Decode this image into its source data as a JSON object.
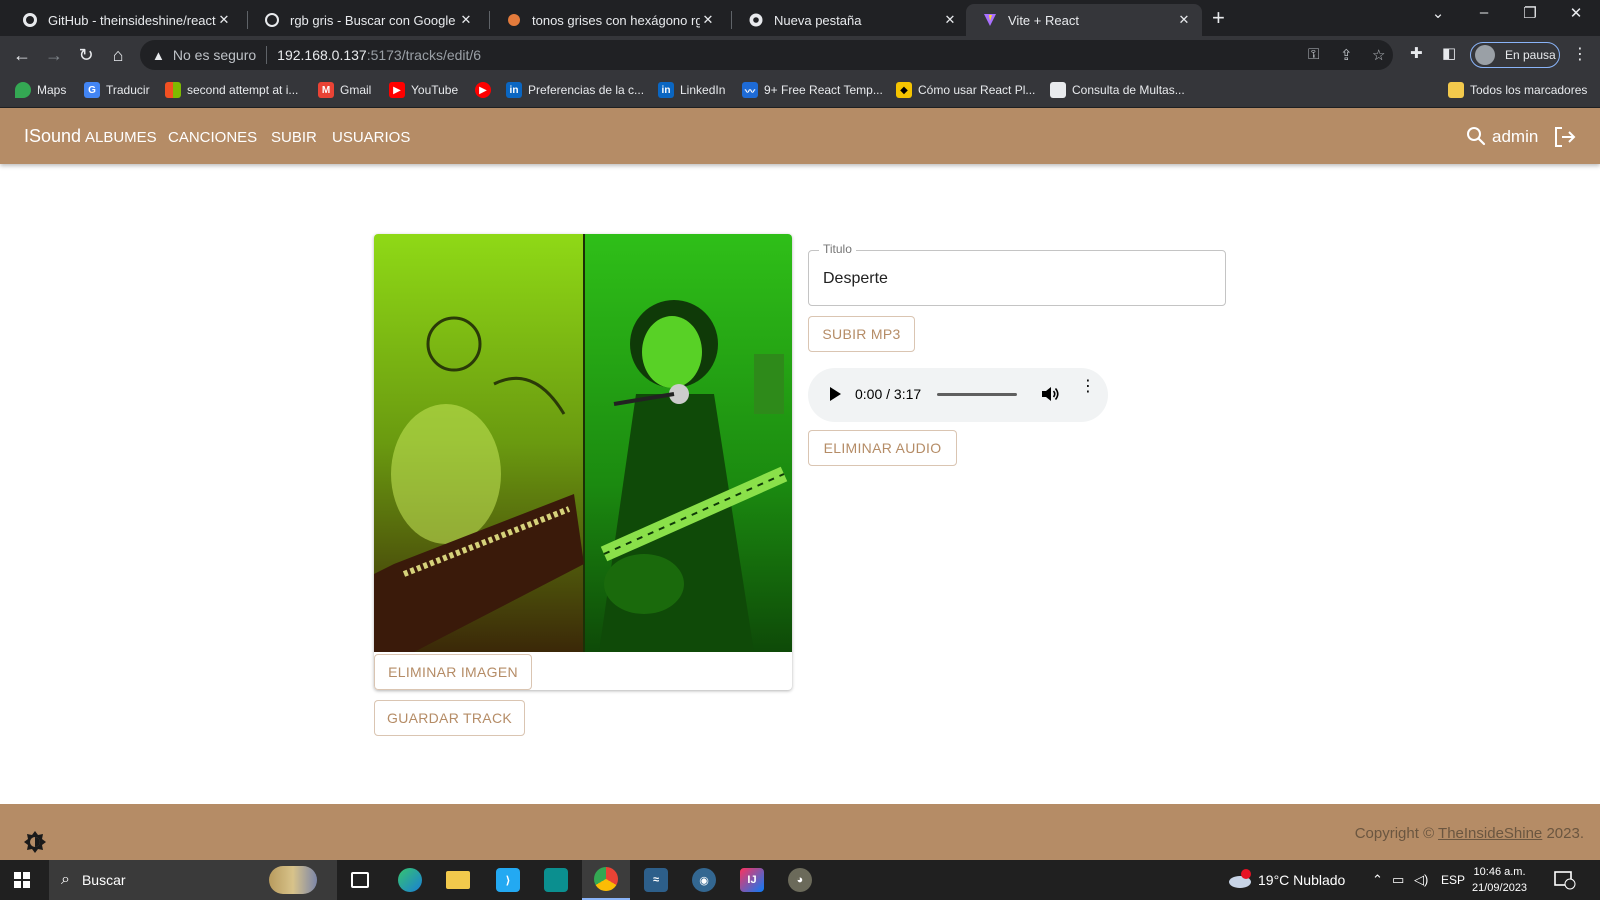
{
  "browser": {
    "tabs": [
      {
        "title": "GitHub - theinsideshine/react-ins",
        "icon": "github-icon"
      },
      {
        "title": "rgb gris - Buscar con Google",
        "icon": "google-icon"
      },
      {
        "title": "tonos grises con hexágono rgb p",
        "icon": "site-icon"
      },
      {
        "title": "Nueva pestaña",
        "icon": "chrome-icon"
      },
      {
        "title": "Vite + React",
        "icon": "vite-icon",
        "active": true
      }
    ],
    "address": {
      "security": "No es seguro",
      "host": "192.168.0.137",
      "path": ":5173/tracks/edit/6"
    },
    "profile_label": "En pausa",
    "bookmarks": [
      {
        "label": "Maps",
        "icon": "maps-icon"
      },
      {
        "label": "Traducir",
        "icon": "translate-icon"
      },
      {
        "label": "second attempt at i...",
        "icon": "microsoft-icon"
      },
      {
        "label": "Gmail",
        "icon": "gmail-icon"
      },
      {
        "label": "YouTube",
        "icon": "youtube-icon"
      },
      {
        "label": "",
        "icon": "youtube-music-icon"
      },
      {
        "label": "Preferencias de la c...",
        "icon": "linkedin-icon"
      },
      {
        "label": "LinkedIn",
        "icon": "linkedin-icon"
      },
      {
        "label": "9+ Free React Temp...",
        "icon": "react-template-icon"
      },
      {
        "label": "Cómo usar React Pl...",
        "icon": "cat-icon"
      },
      {
        "label": "Consulta de Multas...",
        "icon": "page-icon"
      }
    ],
    "all_bookmarks": "Todos los marcadores"
  },
  "app": {
    "brand": "ISound",
    "nav": [
      "ALBUMES",
      "CANCIONES",
      "SUBIR",
      "USUARIOS"
    ],
    "user": "admin",
    "form": {
      "title_label": "Titulo",
      "title_value": "Desperte",
      "upload_mp3": "SUBIR MP3",
      "delete_audio": "ELIMINAR AUDIO",
      "delete_image": "ELIMINAR IMAGEN",
      "save_track": "GUARDAR TRACK"
    },
    "audio": {
      "time": "0:00 / 3:17"
    },
    "footer": {
      "copyright_prefix": "Copyright © ",
      "copyright_link": "TheInsideShine",
      "copyright_year": " 2023."
    },
    "colors": {
      "primary": "#b58c66"
    }
  },
  "taskbar": {
    "search": "Buscar",
    "apps": [
      "task-view-icon",
      "edge-icon",
      "file-explorer-icon",
      "vscode-icon",
      "terminal-icon",
      "chrome-icon",
      "mysql-workbench-icon",
      "postgres-icon",
      "intellij-icon",
      "gimp-icon"
    ],
    "weather": "19°C  Nublado",
    "weather_badge": "1",
    "language": "ESP",
    "time": "10:46 a.m.",
    "date": "21/09/2023",
    "notifications": "1"
  }
}
